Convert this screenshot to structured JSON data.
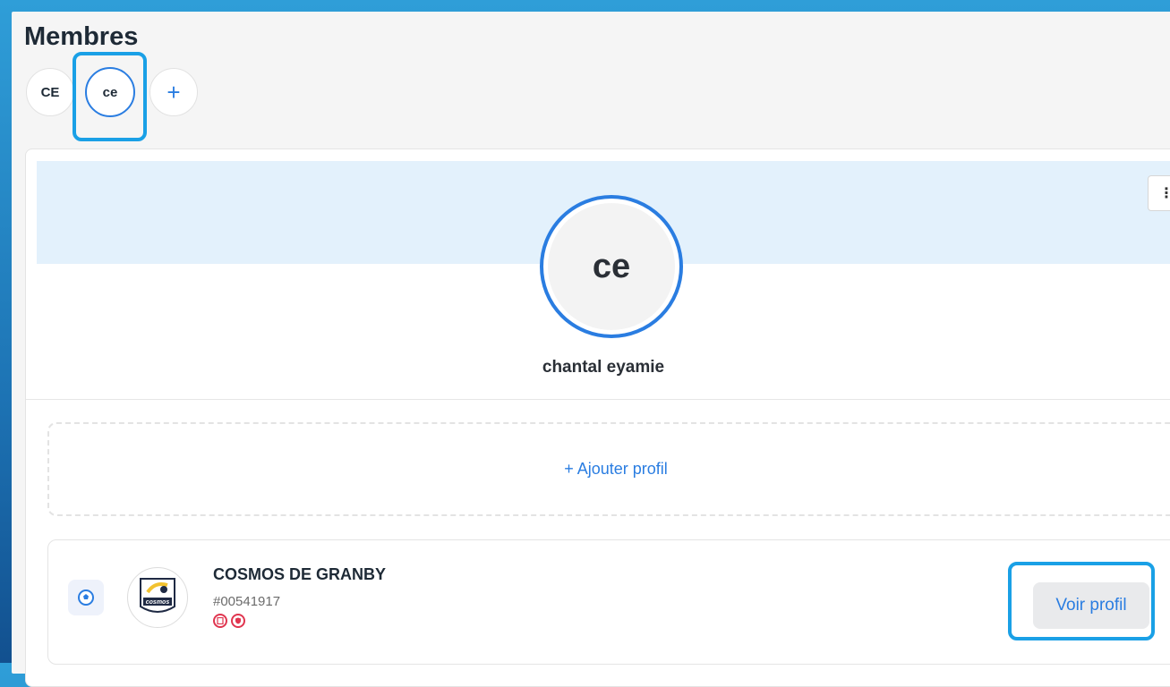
{
  "header": {
    "title": "Membres"
  },
  "members": {
    "chips": [
      {
        "initials": "CE"
      },
      {
        "initials": "ce"
      },
      {
        "initials": "+"
      }
    ]
  },
  "member_card": {
    "avatar_initials": "ce",
    "name": "chantal eyamie",
    "menu_icon": "⋮"
  },
  "actions": {
    "add_profile_label": "+ Ajouter profil"
  },
  "profile": {
    "club_name": "COSMOS DE GRANBY",
    "club_id": "#00541917",
    "view_button": "Voir profil",
    "sport_icon": "soccer-ball-icon",
    "status_icons": [
      "document-icon",
      "shield-icon"
    ],
    "logo_text": "cosmos"
  },
  "colors": {
    "accent": "#2a7de1",
    "highlight": "#1aa0e6",
    "banner": "#e3f1fc",
    "alert": "#e0354f"
  }
}
